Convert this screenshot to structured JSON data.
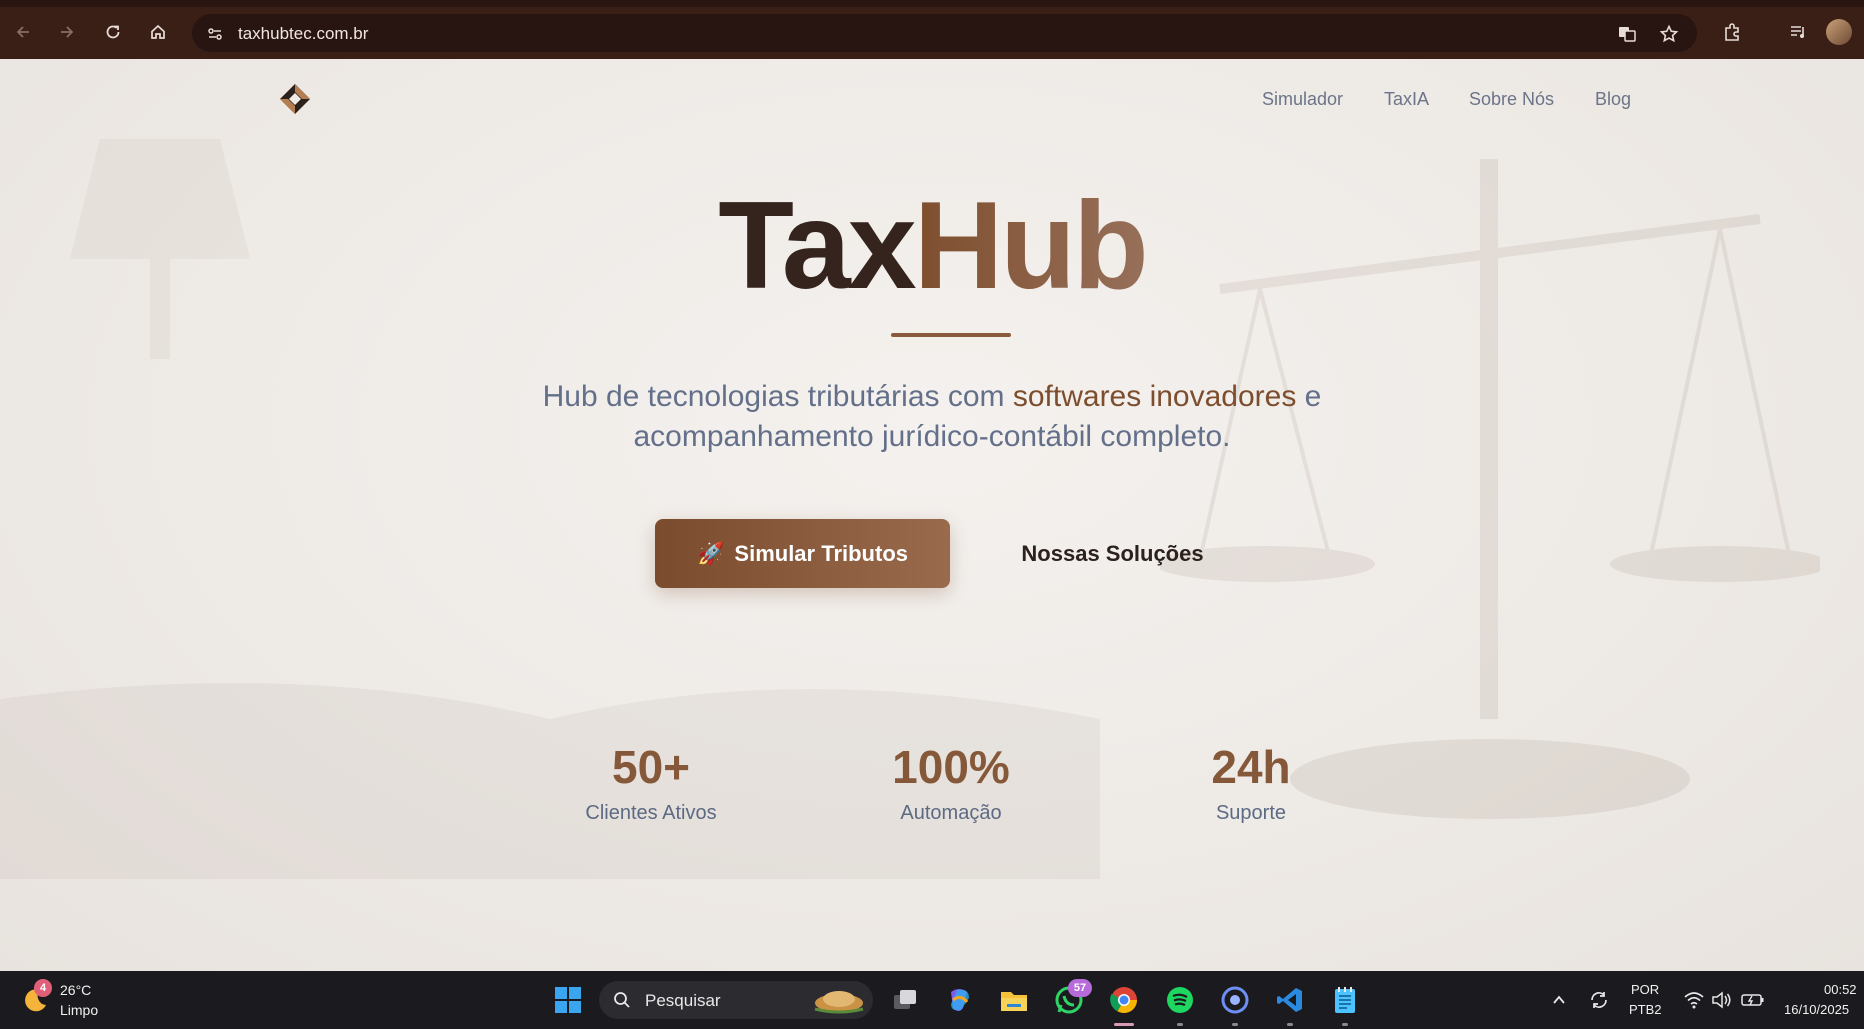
{
  "browser": {
    "url": "taxhubtec.com.br"
  },
  "site": {
    "nav": [
      "Simulador",
      "TaxIA",
      "Sobre Nós",
      "Blog"
    ],
    "title_part1": "Tax",
    "title_part2": "Hub",
    "subtitle_pre": "Hub de tecnologias tributárias com ",
    "subtitle_highlight": "softwares inovadores",
    "subtitle_post": " e",
    "subtitle_line2": "acompanhamento jurídico-contábil completo.",
    "primary_button": "Simular Tributos",
    "primary_button_icon": "🚀",
    "secondary_button": "Nossas Soluções",
    "stats": [
      {
        "value": "50+",
        "label": "Clientes Ativos"
      },
      {
        "value": "100%",
        "label": "Automação"
      },
      {
        "value": "24h",
        "label": "Suporte"
      }
    ]
  },
  "taskbar": {
    "weather_badge": "4",
    "temperature": "26°C",
    "weather": "Limpo",
    "search_placeholder": "Pesquisar",
    "whatsapp_badge": "57",
    "language": "POR",
    "keyboard": "PTB2",
    "time": "00:52",
    "date": "16/10/2025"
  },
  "colors": {
    "accent": "#86583a",
    "browser_frame": "#3a1f17",
    "text_muted": "#64708a"
  }
}
